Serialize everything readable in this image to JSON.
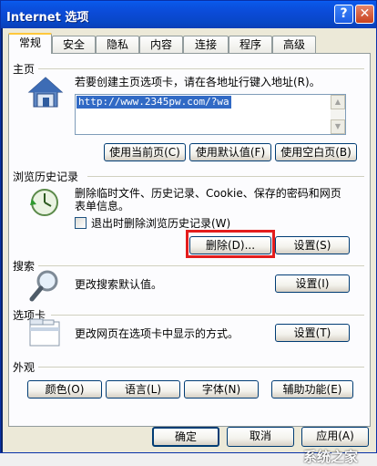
{
  "window": {
    "title": "Internet 选项",
    "help_label": "?",
    "close_label": "✕"
  },
  "tabs": [
    {
      "label": "常规"
    },
    {
      "label": "安全"
    },
    {
      "label": "隐私"
    },
    {
      "label": "内容"
    },
    {
      "label": "连接"
    },
    {
      "label": "程序"
    },
    {
      "label": "高级"
    }
  ],
  "homepage": {
    "title": "主页",
    "description": "若要创建主页选项卡，请在各地址行键入地址(R)。",
    "url": "http://www.2345pw.com/?wa",
    "use_current": "使用当前页(C)",
    "use_default": "使用默认值(F)",
    "use_blank": "使用空白页(B)"
  },
  "history": {
    "title": "浏览历史记录",
    "description_line1": "删除临时文件、历史记录、Cookie、保存的密码和网页",
    "description_line2": "表单信息。",
    "checkbox_label": "退出时删除浏览历史记录(W)",
    "checkbox_checked": false,
    "delete_button": "删除(D)...",
    "settings_button": "设置(S)"
  },
  "search": {
    "title": "搜索",
    "description": "更改搜索默认值。",
    "settings_button": "设置(I)"
  },
  "tabsettings": {
    "title": "选项卡",
    "description": "更改网页在选项卡中显示的方式。",
    "settings_button": "设置(T)"
  },
  "appearance": {
    "title": "外观",
    "colors": "颜色(O)",
    "languages": "语言(L)",
    "fonts": "字体(N)",
    "accessibility": "辅助功能(E)"
  },
  "footer": {
    "ok": "确定",
    "cancel": "取消",
    "apply": "应用(A)"
  },
  "watermark": "系统之家",
  "colors": {
    "highlight": "#e31d1d",
    "title_bar": "#0a56e6"
  }
}
